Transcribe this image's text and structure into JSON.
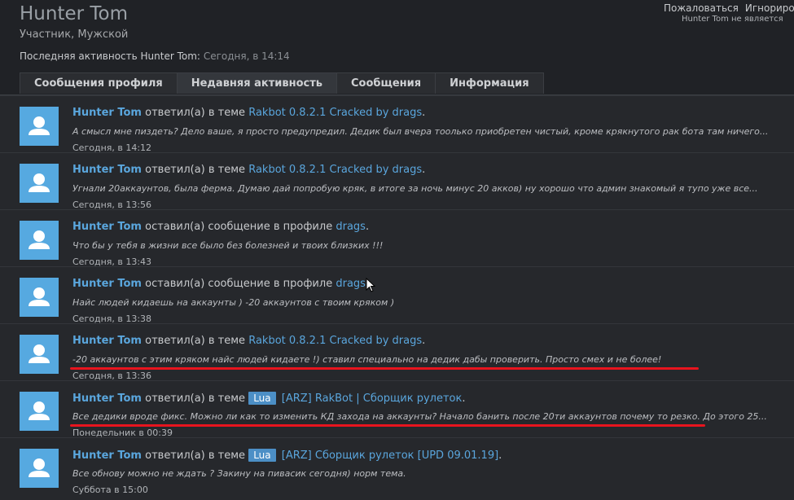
{
  "profile": {
    "name": "Hunter Tom",
    "subtitle": "Участник, Мужской",
    "last_activity_label": "Последняя активность Hunter Tom:",
    "last_activity_time": "Сегодня, в 14:14"
  },
  "actions": {
    "report": "Пожаловаться",
    "ignore": "Игнориро",
    "follow_note": "Hunter Tom не является"
  },
  "tabs": [
    {
      "label": "Сообщения профиля",
      "active": false
    },
    {
      "label": "Недавняя активность",
      "active": true
    },
    {
      "label": "Сообщения",
      "active": false
    },
    {
      "label": "Информация",
      "active": false
    }
  ],
  "items": [
    {
      "user": "Hunter Tom",
      "action": "ответил(а) в теме",
      "prefix": "",
      "target": "Rakbot 0.8.2.1 Cracked by drags",
      "snippet": "А смысл мне пиздеть? Дело ваше, я просто предупредил. Дедик был вчера тоолько приобретен чистый, кроме крякнутого рак бота там ничего...",
      "time": "Сегодня, в 14:12"
    },
    {
      "user": "Hunter Tom",
      "action": "ответил(а) в теме",
      "prefix": "",
      "target": "Rakbot 0.8.2.1 Cracked by drags",
      "snippet": "Угнали 20аккаунтов, была ферма. Думаю дай попробую кряк, в итоге за ночь минус 20 акков) ну хорошо что админ знакомый я тупо уже все...",
      "time": "Сегодня, в 13:56"
    },
    {
      "user": "Hunter Tom",
      "action": "оставил(а) сообщение в профиле",
      "prefix": "",
      "target": "drags",
      "snippet": "Что бы у тебя в жизни все было без болезней и твоих близких !!!",
      "time": "Сегодня, в 13:43"
    },
    {
      "user": "Hunter Tom",
      "action": "оставил(а) сообщение в профиле",
      "prefix": "",
      "target": "drags",
      "snippet": "Найс людей кидаешь на аккаунты ) -20 аккаунтов с твоим кряком )",
      "time": "Сегодня, в 13:38"
    },
    {
      "user": "Hunter Tom",
      "action": "ответил(а) в теме",
      "prefix": "",
      "target": "Rakbot 0.8.2.1 Cracked by drags",
      "snippet": "-20 аккаунтов с этим кряком найс людей кидаете !) ставил специально на дедик дабы проверить. Просто смех и не более!",
      "time": "Сегодня, в 13:36"
    },
    {
      "user": "Hunter Tom",
      "action": "ответил(а) в теме",
      "prefix": "Lua",
      "target": "[ARZ] RakBot | Сборщик рулеток",
      "snippet": "Все дедики вроде фикс. Можно ли как то изменить КД захода на аккаунты? Начало банить после 20ти аккаунтов почему то резко. До этого 25...",
      "time": "Понедельник в 00:39"
    },
    {
      "user": "Hunter Tom",
      "action": "ответил(а) в теме",
      "prefix": "Lua",
      "target": "[ARZ] Сборщик рулеток [UPD 09.01.19]",
      "snippet": "Все обнову можно не ждать ? Закину на пивасик сегодня) норм тема.",
      "time": "Суббота в 15:00"
    }
  ],
  "colors": {
    "background": "#202226",
    "link": "#5aa6dd",
    "avatar": "#56a9e0",
    "prefix_badge": "#4c8fc6",
    "annotation_red": "#e8141e"
  }
}
